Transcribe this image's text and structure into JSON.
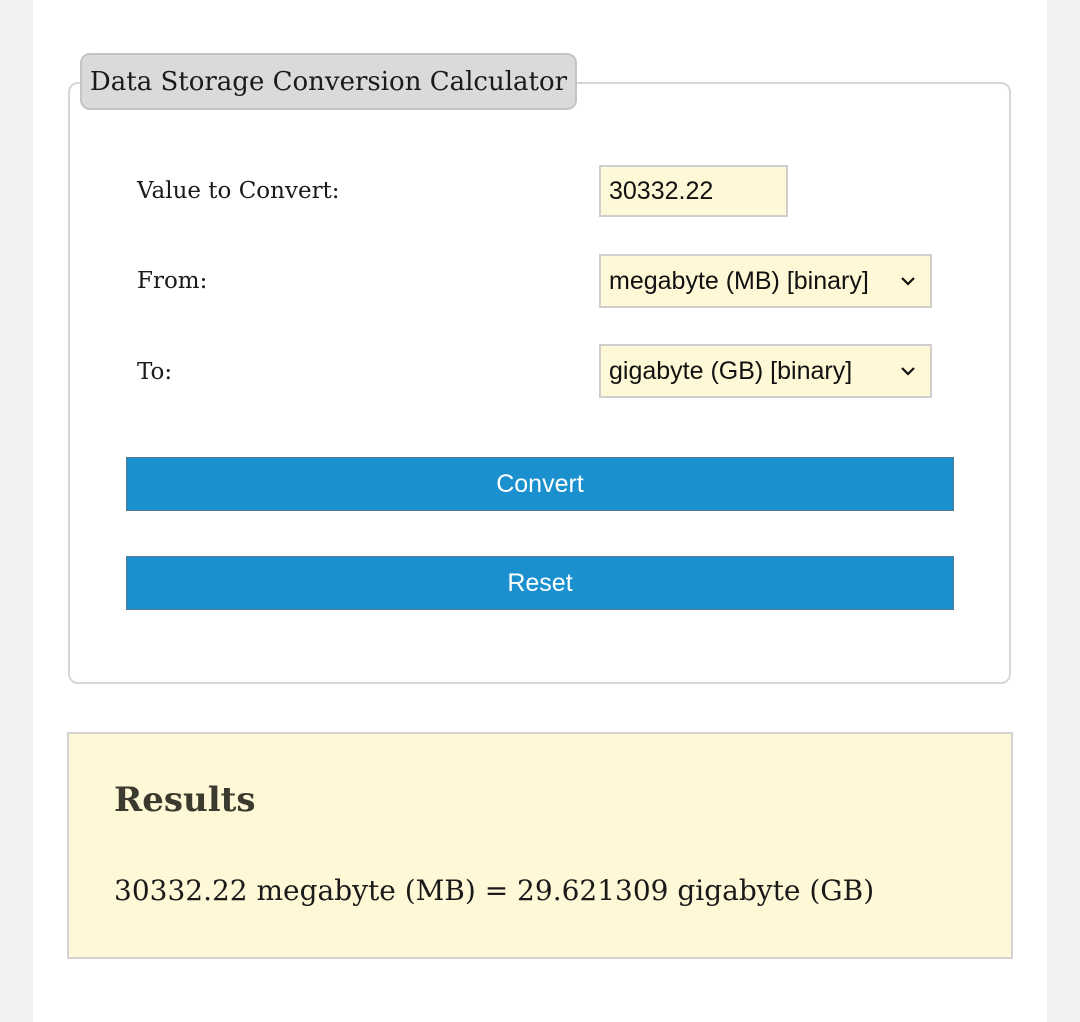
{
  "calculator": {
    "title": "Data Storage Conversion Calculator",
    "value_label": "Value to Convert:",
    "value": "30332.22",
    "from_label": "From:",
    "from_selected": "megabyte (MB) [binary]",
    "to_label": "To:",
    "to_selected": "gigabyte (GB) [binary]",
    "convert_label": "Convert",
    "reset_label": "Reset"
  },
  "results": {
    "title": "Results",
    "text": "30332.22 megabyte (MB) = 29.621309 gigabyte (GB)"
  },
  "colors": {
    "button_blue": "#1b90cf",
    "input_bg": "#fff8d6",
    "legend_bg": "#dadada"
  },
  "icons": {
    "select_arrow": "chevron-down-icon"
  }
}
